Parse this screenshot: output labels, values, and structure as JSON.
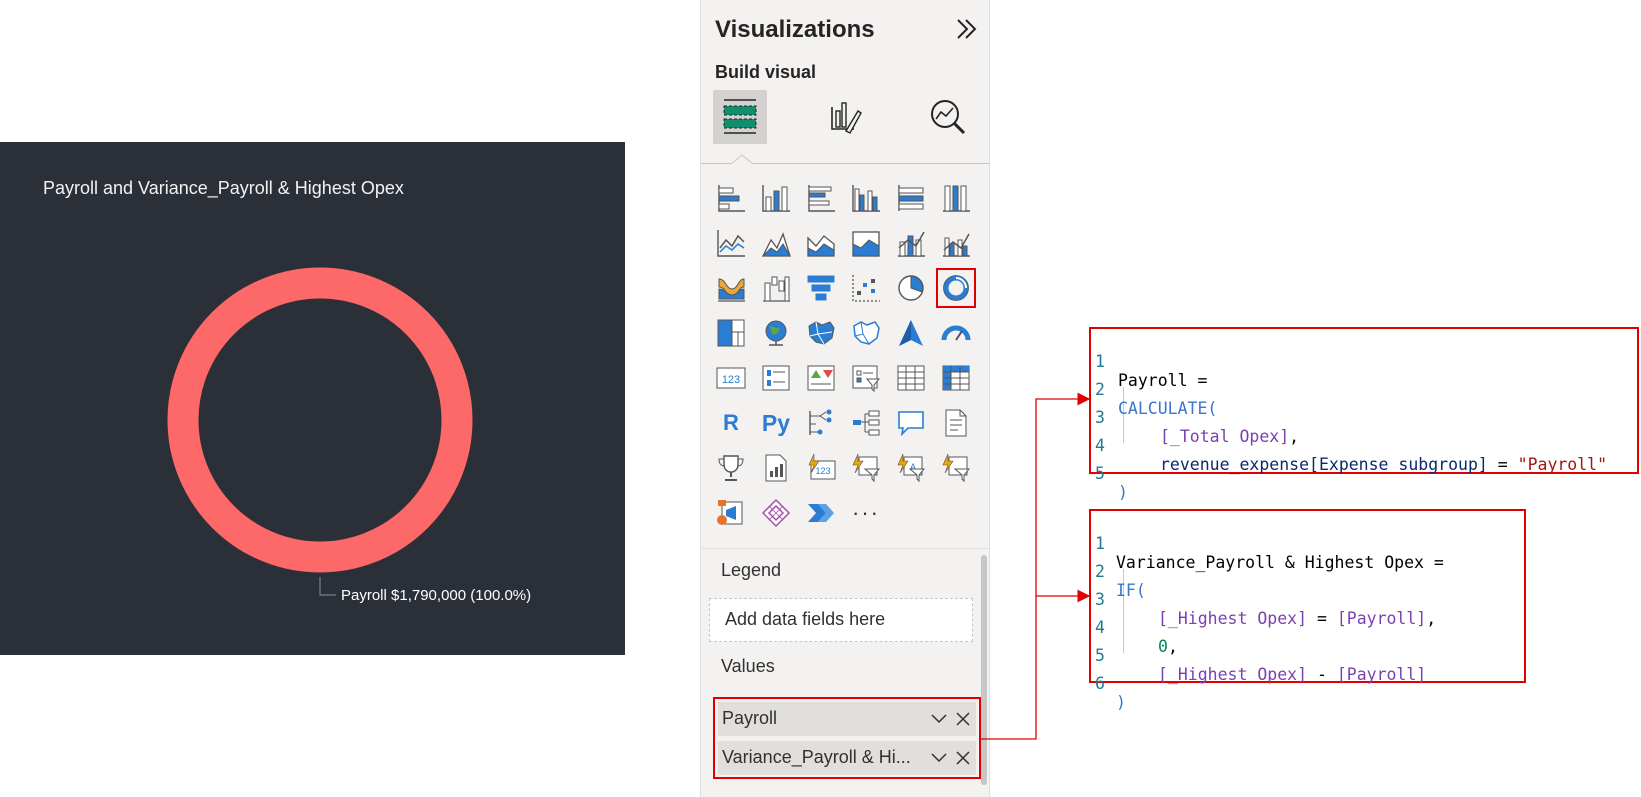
{
  "chart": {
    "title": "Payroll and Variance_Payroll & Highest Opex",
    "slice_label": "Payroll $1,790,000 (100.0%)",
    "colors": {
      "background": "#2b3038",
      "slice": "#fd6868"
    }
  },
  "chart_data": {
    "type": "pie",
    "variant": "donut",
    "title": "Payroll and Variance_Payroll & Highest Opex",
    "slices": [
      {
        "label": "Payroll",
        "value": 1790000,
        "percent": 100.0
      }
    ],
    "data_labels": [
      "Payroll $1,790,000 (100.0%)"
    ]
  },
  "viz_pane": {
    "title": "Visualizations",
    "build_label": "Build visual",
    "modes": [
      "build-visual-icon",
      "format-visual-icon",
      "analytics-icon"
    ],
    "icons": [
      "stacked-bar-chart-icon",
      "stacked-column-chart-icon",
      "clustered-bar-chart-icon",
      "clustered-column-chart-icon",
      "100-stacked-bar-chart-icon",
      "100-stacked-column-chart-icon",
      "line-chart-icon",
      "area-chart-icon",
      "stacked-area-chart-icon",
      "100-stacked-area-chart-icon",
      "line-and-stacked-column-chart-icon",
      "line-and-clustered-column-chart-icon",
      "ribbon-chart-icon",
      "waterfall-chart-icon",
      "funnel-chart-icon",
      "scatter-chart-icon",
      "pie-chart-icon",
      "donut-chart-icon",
      "treemap-icon",
      "map-icon",
      "filled-map-icon",
      "shape-map-icon",
      "azure-map-icon",
      "gauge-icon",
      "card-icon",
      "multi-row-card-icon",
      "kpi-icon",
      "slicer-icon",
      "table-icon",
      "matrix-icon",
      "r-visual-icon",
      "python-visual-icon",
      "key-influencers-icon",
      "decomposition-tree-icon",
      "qa-icon",
      "smart-narrative-icon",
      "goals-icon",
      "paginated-report-icon",
      "power-apps-card-icon",
      "power-apps-slicer-icon",
      "power-apps-filter-icon",
      "power-automate-icon",
      "power-apps-icon",
      "diamond-visual-icon",
      "power-automate-flow-icon",
      "more-visuals-icon"
    ],
    "r_label": "R",
    "py_label": "Py",
    "more_label": "···",
    "legend_label": "Legend",
    "legend_placeholder": "Add data fields here",
    "values_label": "Values",
    "values": [
      "Payroll",
      "Variance_Payroll & Hi..."
    ]
  },
  "code_payroll": {
    "line_numbers": [
      "1",
      "2",
      "3",
      "4",
      "5"
    ],
    "l1": "Payroll =",
    "l2": "CALCULATE(",
    "l3": "[_Total Opex]",
    "l3_comma": ",",
    "l4_table": "revenue_expense",
    "l4_col": "[Expense subgroup]",
    "l4_eq": " = ",
    "l4_str": "\"Payroll\"",
    "l5": ")"
  },
  "code_variance": {
    "line_numbers": [
      "1",
      "2",
      "3",
      "4",
      "5",
      "6"
    ],
    "l1": "Variance_Payroll & Highest Opex =",
    "l2": "IF(",
    "l3_a": "[_Highest Opex]",
    "l3_op": " = ",
    "l3_b": "[Payroll]",
    "l3_comma": ",",
    "l4": "0",
    "l4_comma": ",",
    "l5_a": "[_Highest Opex]",
    "l5_op": " - ",
    "l5_b": "[Payroll]",
    "l6": ")"
  }
}
